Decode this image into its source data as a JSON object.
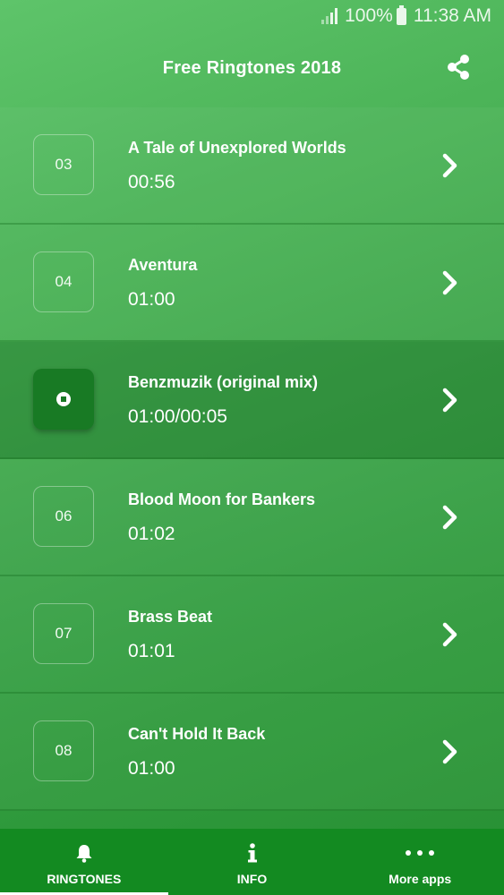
{
  "status_bar": {
    "battery": "100%",
    "time": "11:38 AM",
    "icons": [
      "signal-icon",
      "battery-icon"
    ]
  },
  "header": {
    "title": "Free Ringtones 2018",
    "share_icon": "share-icon"
  },
  "ringtones": [
    {
      "number": "03",
      "title": "A Tale of Unexplored Worlds",
      "duration": "00:56",
      "playing": false
    },
    {
      "number": "04",
      "title": "Aventura",
      "duration": "01:00",
      "playing": false
    },
    {
      "number": "",
      "title": "Benzmuzik (original mix)",
      "duration": "01:00/00:05",
      "playing": true
    },
    {
      "number": "06",
      "title": "Blood Moon for Bankers",
      "duration": "01:02",
      "playing": false
    },
    {
      "number": "07",
      "title": "Brass Beat",
      "duration": "01:01",
      "playing": false
    },
    {
      "number": "08",
      "title": "Can't Hold It Back",
      "duration": "01:00",
      "playing": false
    }
  ],
  "tabs": [
    {
      "label": "RINGTONES",
      "icon": "bell-icon",
      "selected": true
    },
    {
      "label": "INFO",
      "icon": "info-icon",
      "selected": false
    },
    {
      "label": "More apps",
      "icon": "more-dots-icon",
      "selected": false
    }
  ],
  "colors": {
    "background_top": "#5ec46a",
    "background_bottom": "#278f33",
    "tabbar": "#138a21",
    "active_badge": "#187a24"
  }
}
